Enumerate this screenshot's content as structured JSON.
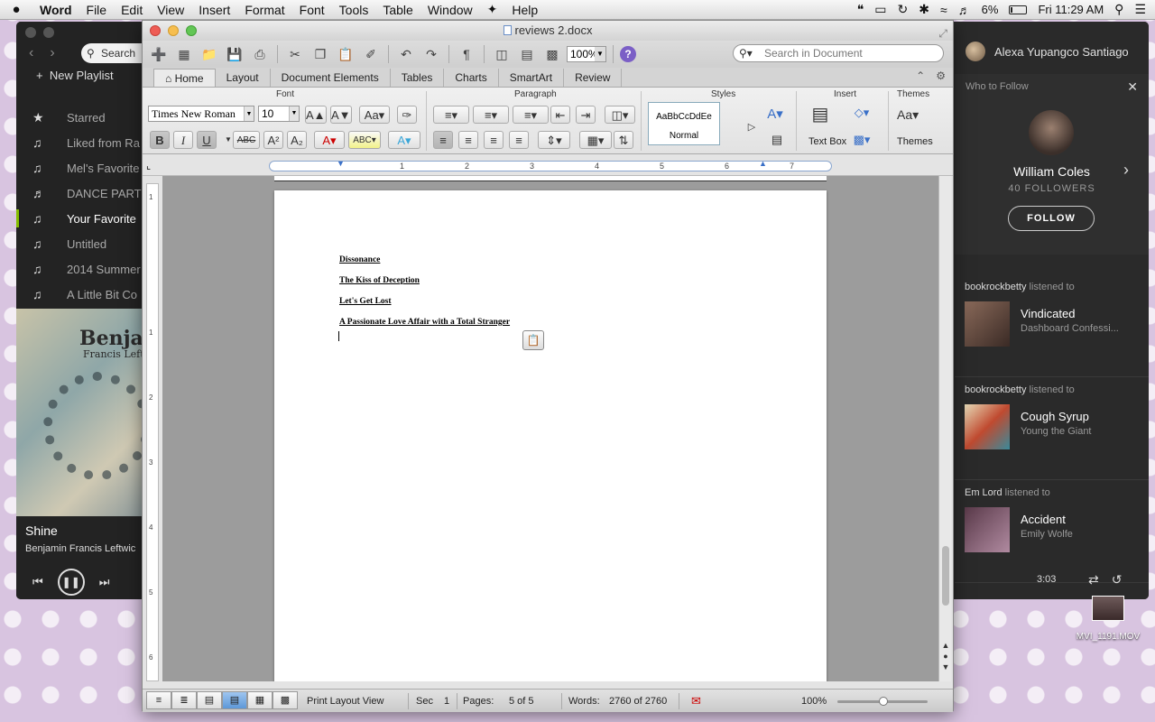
{
  "menubar": {
    "apple": "",
    "app": "Word",
    "items": [
      "File",
      "Edit",
      "View",
      "Insert",
      "Format",
      "Font",
      "Tools",
      "Table",
      "Window",
      "Help"
    ],
    "battery": "6%",
    "clock": "Fri 11:29 AM"
  },
  "spotify": {
    "search": "Search",
    "new_playlist": "New Playlist",
    "playlists": [
      {
        "label": "Starred",
        "icon": "star-icon"
      },
      {
        "label": "Liked from Ra",
        "icon": "music-note-icon"
      },
      {
        "label": "Mel's Favorite",
        "icon": "music-note-icon"
      },
      {
        "label": "DANCE PARTY",
        "icon": "collab-note-icon"
      },
      {
        "label": "Your Favorite",
        "icon": "music-note-icon",
        "active": true
      },
      {
        "label": "Untitled",
        "icon": "music-note-icon"
      },
      {
        "label": "2014 Summer",
        "icon": "music-note-icon"
      },
      {
        "label": "A Little Bit Co",
        "icon": "music-note-icon"
      }
    ],
    "album_art_text": "Benjam",
    "album_art_sub": "Francis Leftw",
    "now_playing": {
      "title": "Shine",
      "artist": "Benjamin Francis Leftwic"
    },
    "time": "3:03",
    "user": "Alexa Yupangco Santiago",
    "who_to_follow": {
      "heading": "Who to Follow",
      "name": "William Coles",
      "followers": "40 FOLLOWERS",
      "follow_label": "FOLLOW"
    },
    "feed": [
      {
        "user": "bookrockbetty",
        "action": "listened to",
        "title": "Vindicated",
        "artist": "Dashboard Confessi...",
        "art_color": "#6b4a3f"
      },
      {
        "user": "bookrockbetty",
        "action": "listened to",
        "title": "Cough Syrup",
        "artist": "Young the Giant",
        "art_color": "#c9b27a"
      },
      {
        "user": "Em Lord",
        "action": "listened to",
        "title": "Accident",
        "artist": "Emily Wolfe",
        "art_color": "#7a4a6a"
      }
    ]
  },
  "desktop": {
    "file_label": "MVI_1191.MOV"
  },
  "word": {
    "title": "reviews 2.docx",
    "zoom": "100%",
    "search_placeholder": "Search in Document",
    "tabs": [
      "Home",
      "Layout",
      "Document Elements",
      "Tables",
      "Charts",
      "SmartArt",
      "Review"
    ],
    "groups": {
      "font": "Font",
      "paragraph": "Paragraph",
      "styles": "Styles",
      "insert": "Insert",
      "themes": "Themes"
    },
    "font_name": "Times New Roman",
    "font_size": "10",
    "style_preview": "AaBbCcDdEe",
    "style_name": "Normal",
    "text_box_label": "Text Box",
    "themes_label": "Themes",
    "ruler_ticks": [
      "1",
      "2",
      "3",
      "4",
      "5",
      "6",
      "7"
    ],
    "vruler_ticks": [
      "1",
      "1",
      "2",
      "3",
      "4",
      "5",
      "6"
    ],
    "document_lines": [
      "Dissonance",
      "The Kiss of Deception",
      "Let's Get Lost",
      "A Passionate Love Affair with a Total Stranger"
    ],
    "status": {
      "view": "Print Layout View",
      "sec_label": "Sec",
      "sec_value": "1",
      "pages_label": "Pages:",
      "pages_value": "5 of 5",
      "words_label": "Words:",
      "words_value": "2760 of 2760",
      "zoom": "100%"
    }
  }
}
